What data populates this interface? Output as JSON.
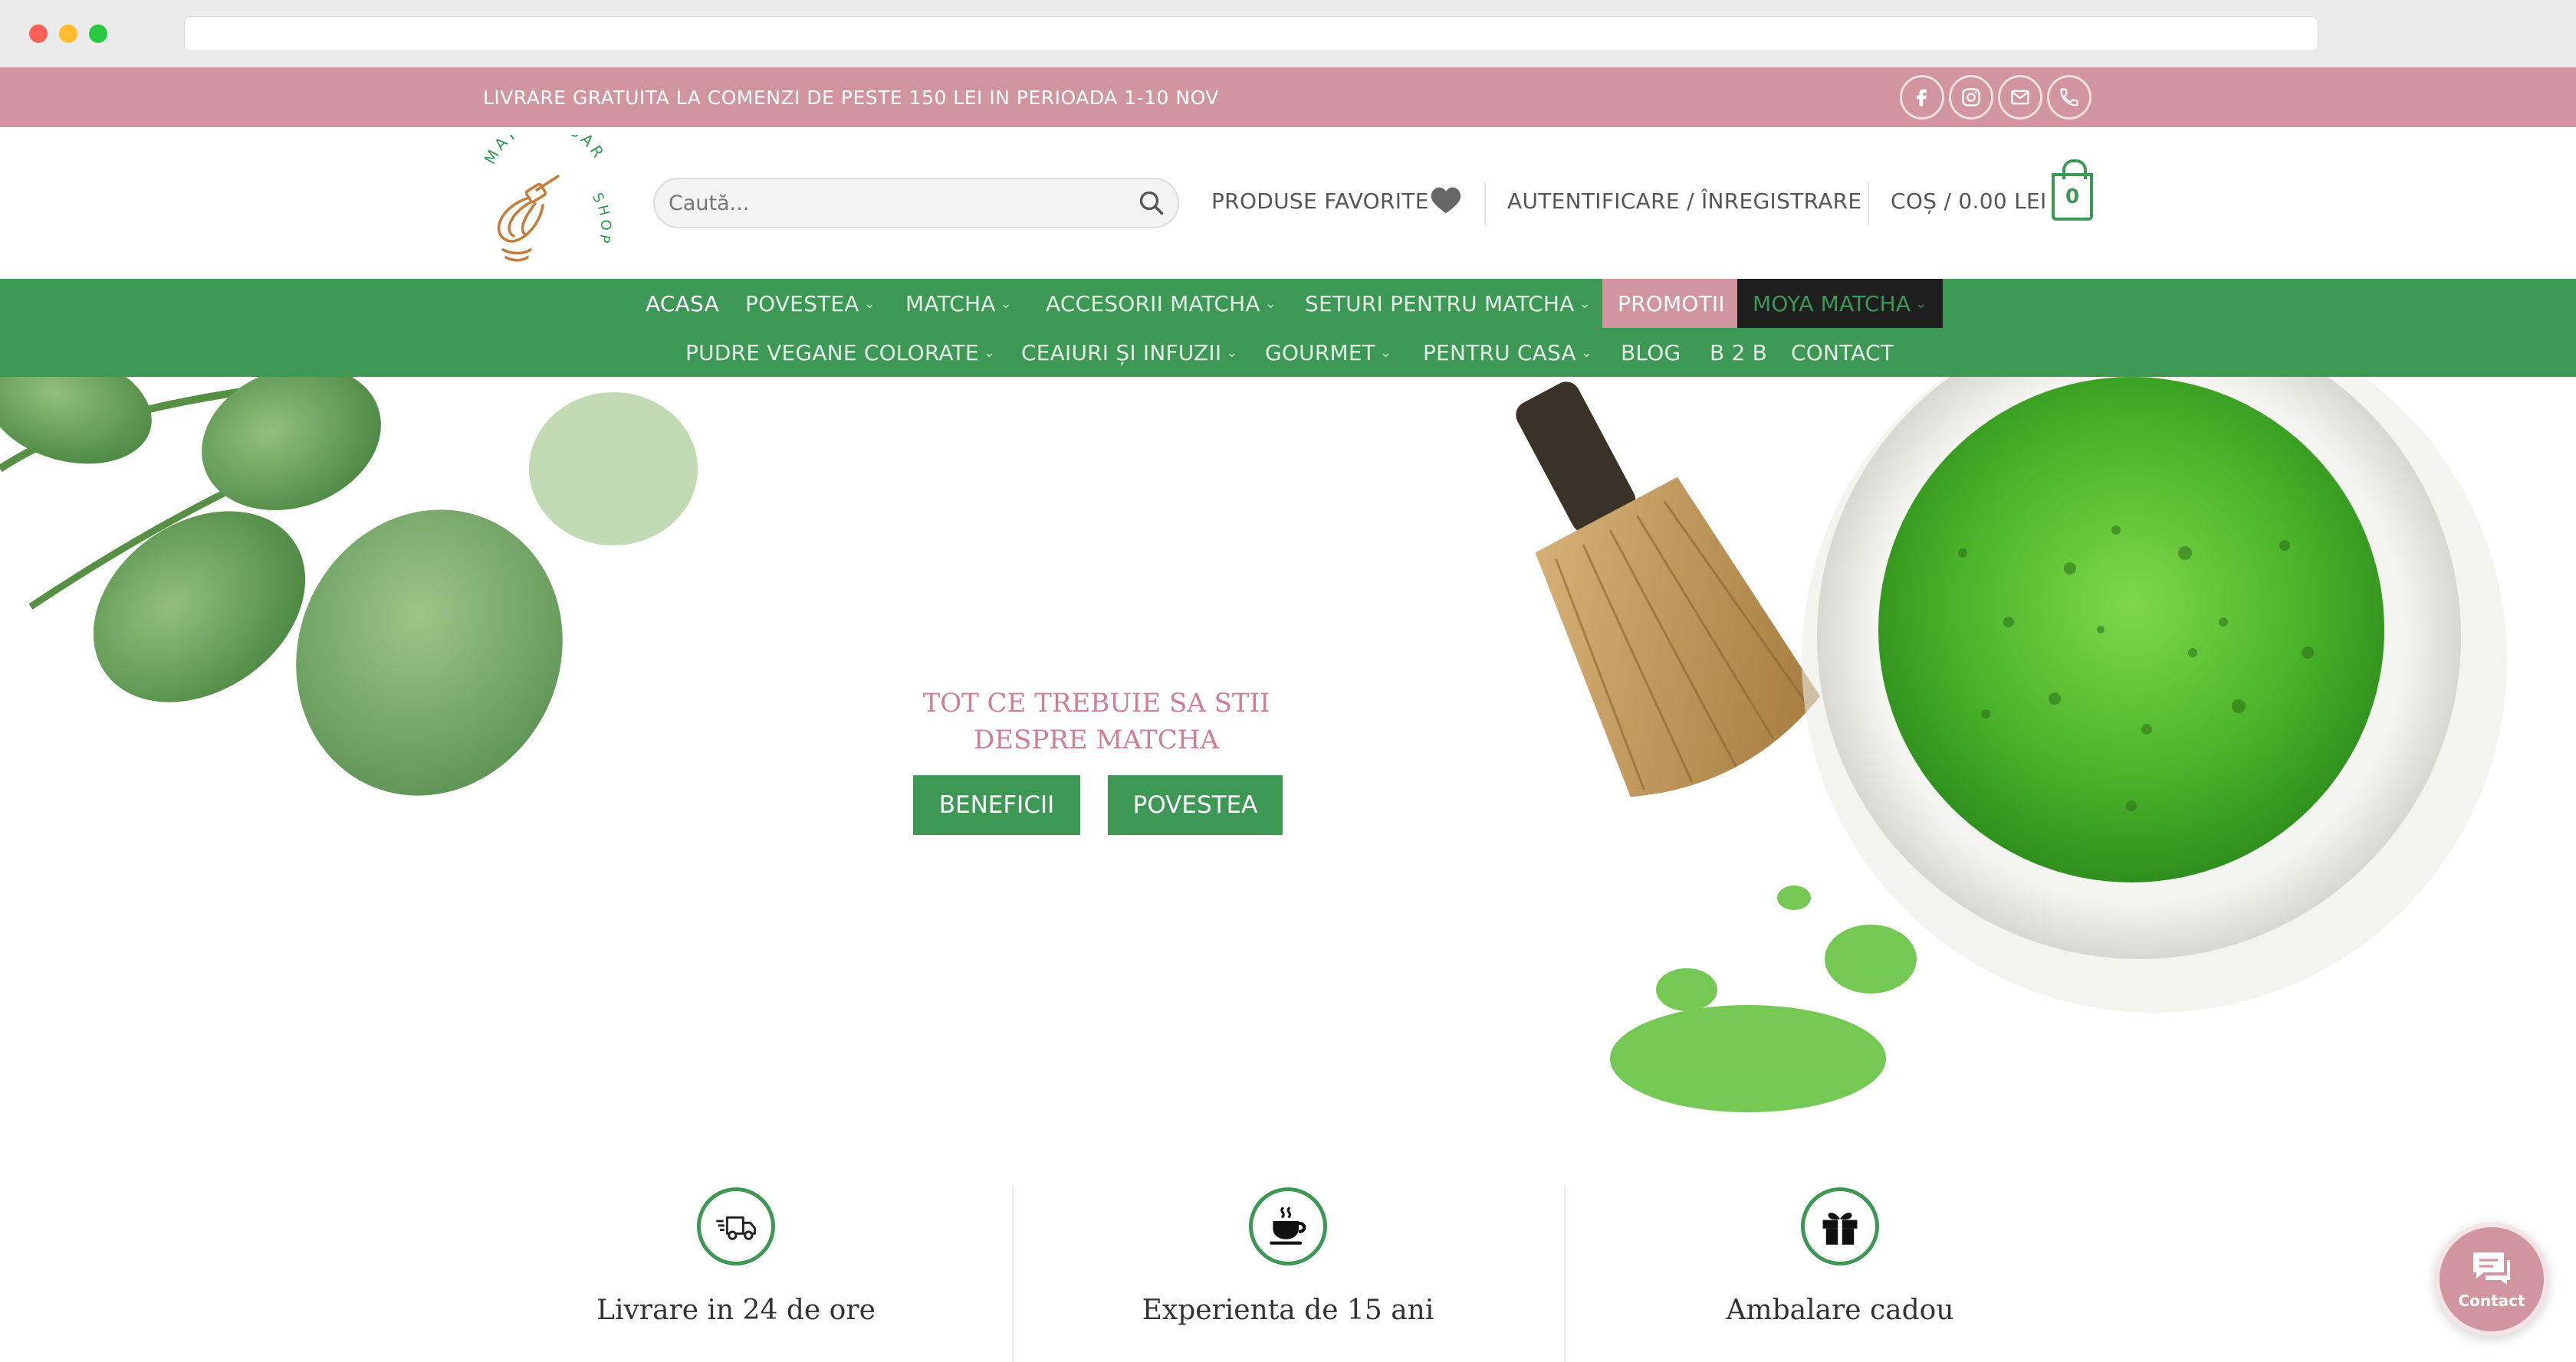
{
  "browser": {
    "url": ""
  },
  "top_bar": {
    "promo_text": "LIVRARE GRATUITA LA COMENZI DE PESTE 150 LEI IN PERIOADA 1-10 NOV",
    "social_icons": [
      "facebook-icon",
      "instagram-icon",
      "email-icon",
      "phone-icon"
    ]
  },
  "header": {
    "logo_text_top": "MATCHA BAR",
    "logo_text_side": "SHOP",
    "search_placeholder": "Caută...",
    "favorites_label": "PRODUSE FAVORITE",
    "account_label": "AUTENTIFICARE / ÎNREGISTRARE",
    "cart_label": "COȘ / 0.00 LEI",
    "cart_count": "0"
  },
  "nav": {
    "row1": [
      {
        "label": "ACASA",
        "dropdown": false
      },
      {
        "label": "POVESTEA",
        "dropdown": true
      },
      {
        "label": "MATCHA",
        "dropdown": true
      },
      {
        "label": "ACCESORII MATCHA",
        "dropdown": true
      },
      {
        "label": "SETURI PENTRU MATCHA",
        "dropdown": true
      },
      {
        "label": "PROMOTII",
        "dropdown": false
      },
      {
        "label": "MOYA MATCHA",
        "dropdown": true
      }
    ],
    "row2": [
      {
        "label": "PUDRE VEGANE COLORATE",
        "dropdown": true
      },
      {
        "label": "CEAIURI ȘI INFUZII",
        "dropdown": true
      },
      {
        "label": "GOURMET",
        "dropdown": true
      },
      {
        "label": "PENTRU CASA",
        "dropdown": true
      },
      {
        "label": "BLOG",
        "dropdown": false
      },
      {
        "label": "B 2 B",
        "dropdown": false
      },
      {
        "label": "CONTACT",
        "dropdown": false
      }
    ]
  },
  "hero": {
    "title": "TOT CE TREBUIE SA STII DESPRE MATCHA",
    "buttons": [
      "BENEFICII",
      "POVESTEA"
    ]
  },
  "features": [
    {
      "title": "Livrare in 24 de ore",
      "icon": "delivery-truck-icon"
    },
    {
      "title": "Experienta de 15 ani",
      "icon": "coffee-cup-icon"
    },
    {
      "title": "Ambalare cadou",
      "icon": "gift-icon"
    }
  ],
  "contact_widget": {
    "label": "Contact",
    "icon": "chat-icon"
  },
  "colors": {
    "brand_green": "#3d9755",
    "brand_pink": "#d0959f",
    "hero_title": "#d07f91",
    "moya_bg": "#1e1e1e"
  }
}
